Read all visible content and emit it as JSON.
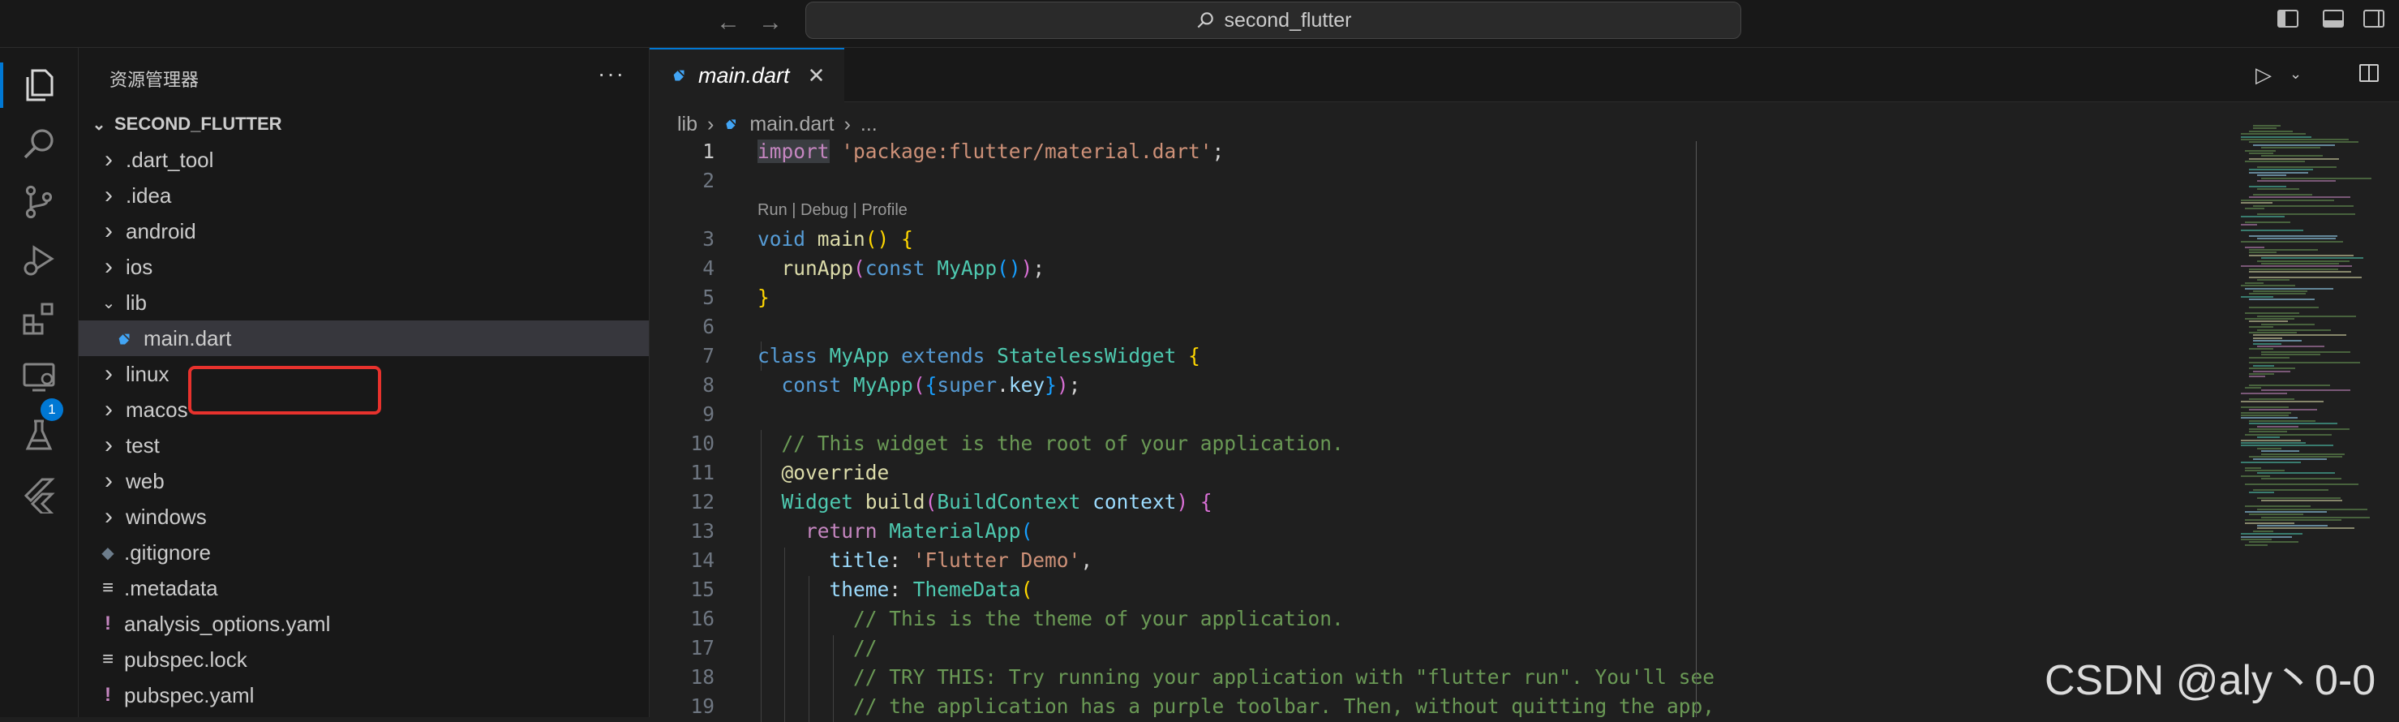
{
  "titlebar": {
    "search_text": "second_flutter"
  },
  "activity": {
    "extensions_badge": "1"
  },
  "sidebar": {
    "title": "资源管理器",
    "more": "···",
    "root": "SECOND_FLUTTER",
    "items": [
      {
        "label": ".dart_tool",
        "kind": "folder"
      },
      {
        "label": ".idea",
        "kind": "folder"
      },
      {
        "label": "android",
        "kind": "folder"
      },
      {
        "label": "ios",
        "kind": "folder"
      },
      {
        "label": "lib",
        "kind": "folder-open"
      },
      {
        "label": "main.dart",
        "kind": "dart"
      },
      {
        "label": "linux",
        "kind": "folder"
      },
      {
        "label": "macos",
        "kind": "folder"
      },
      {
        "label": "test",
        "kind": "folder"
      },
      {
        "label": "web",
        "kind": "folder"
      },
      {
        "label": "windows",
        "kind": "folder"
      },
      {
        "label": ".gitignore",
        "kind": "git"
      },
      {
        "label": ".metadata",
        "kind": "lines"
      },
      {
        "label": "analysis_options.yaml",
        "kind": "yaml"
      },
      {
        "label": "pubspec.lock",
        "kind": "lines"
      },
      {
        "label": "pubspec.yaml",
        "kind": "yaml"
      }
    ]
  },
  "editor": {
    "tab_label": "main.dart",
    "breadcrumb": {
      "folder": "lib",
      "file": "main.dart",
      "more": "..."
    },
    "codelens": "Run | Debug | Profile",
    "line_numbers": [
      "1",
      "2",
      "3",
      "4",
      "5",
      "6",
      "7",
      "8",
      "9",
      "10",
      "11",
      "12",
      "13",
      "14",
      "15",
      "16",
      "17",
      "18",
      "19"
    ]
  },
  "colors": {
    "accent": "#0078d4",
    "highlight_box": "#e8322d",
    "dart": "#42a5f5"
  },
  "watermark": "CSDN @aly丶0-0"
}
